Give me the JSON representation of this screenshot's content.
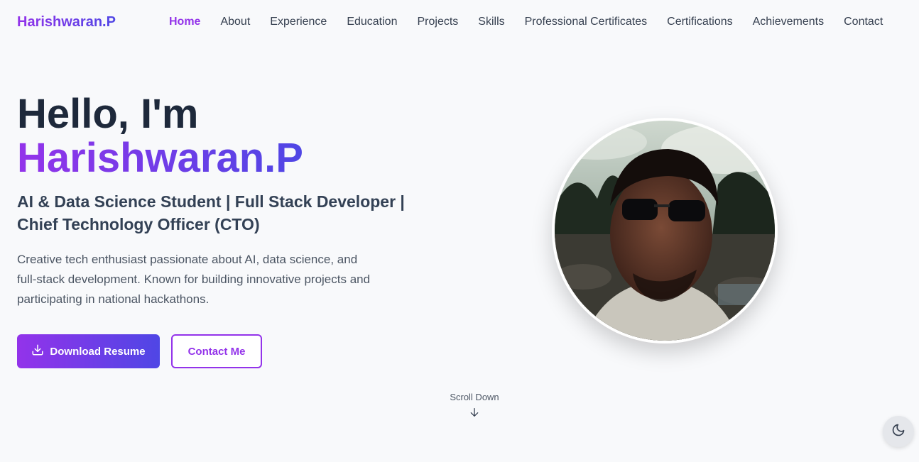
{
  "brand": "Harishwaran.P",
  "nav": {
    "items": [
      "Home",
      "About",
      "Experience",
      "Education",
      "Projects",
      "Skills",
      "Professional Certificates",
      "Certifications",
      "Achievements",
      "Contact"
    ],
    "active": "Home"
  },
  "hero": {
    "greeting": "Hello, I'm",
    "name": "Harishwaran.P",
    "subtitle": "AI & Data Science Student | Full Stack Developer | Chief Technology Officer (CTO)",
    "description": "Creative tech enthusiast passionate about AI, data science, and full-stack development. Known for building innovative projects and participating in national hackathons.",
    "primary_button": "Download Resume",
    "secondary_button": "Contact Me"
  },
  "scroll": {
    "label": "Scroll Down"
  },
  "icons": {
    "download": "download-icon",
    "arrow": "arrow-down-icon",
    "theme": "moon-icon"
  },
  "colors": {
    "accent": "#9333ea",
    "accent_end": "#4f46e5",
    "background": "#f8f9fb",
    "heading": "#1e293b"
  }
}
